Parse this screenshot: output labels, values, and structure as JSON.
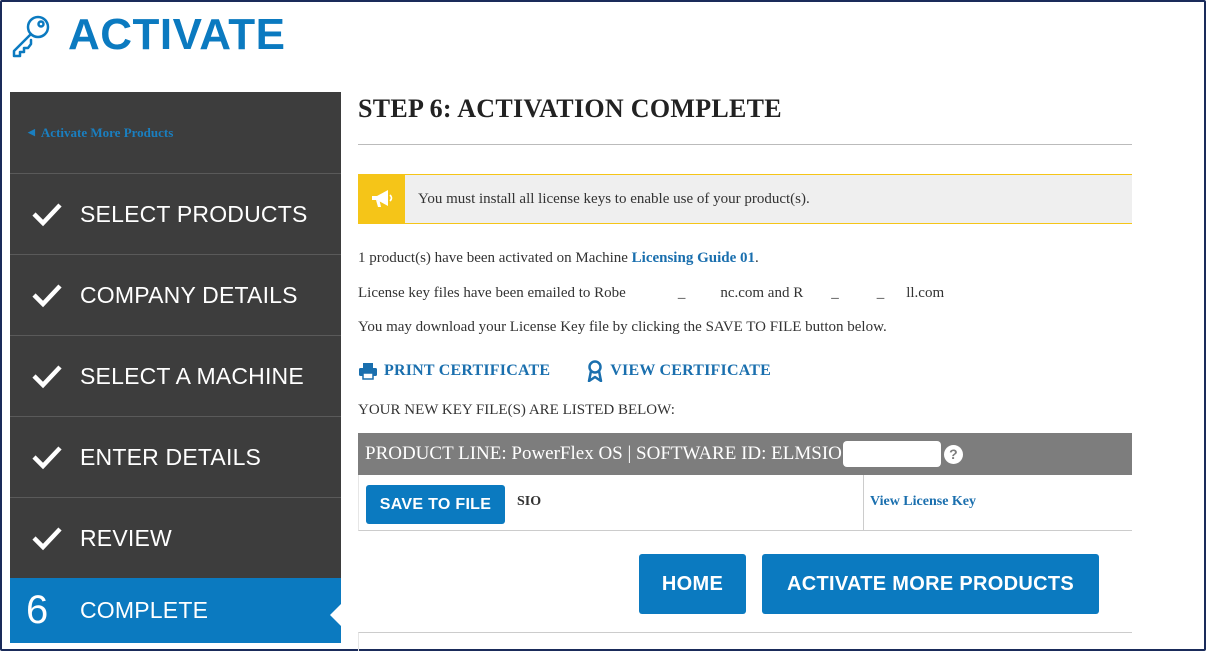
{
  "header": {
    "title": "ACTIVATE",
    "icon": "key-icon",
    "accent_color": "#0b7ac0"
  },
  "sidebar": {
    "back_link": "Activate More Products",
    "steps": [
      {
        "label": "SELECT PRODUCTS",
        "state": "done"
      },
      {
        "label": "COMPANY DETAILS",
        "state": "done"
      },
      {
        "label": "SELECT A MACHINE",
        "state": "done"
      },
      {
        "label": "ENTER DETAILS",
        "state": "done"
      },
      {
        "label": "REVIEW",
        "state": "done"
      },
      {
        "label": "COMPLETE",
        "state": "active",
        "number": "6"
      }
    ],
    "background": "#3d3d3d",
    "active_color": "#0b7ac0"
  },
  "main": {
    "step_title": "STEP 6: ACTIVATION COMPLETE",
    "notice": {
      "icon": "megaphone-icon",
      "text": "You must install all license keys to enable use of your product(s)."
    },
    "activated_prefix": "1 product(s) have been activated on Machine ",
    "machine_name": "Licensing Guide 01",
    "activated_suffix": ".",
    "emailed_prefix": "License key files have been emailed to Robe",
    "emailed_mid1": "nc.com and R",
    "emailed_mid2": "ll.com",
    "download_text": "You may download your License Key file by clicking the SAVE TO FILE button below.",
    "print_certificate": "PRINT CERTIFICATE",
    "view_certificate": "VIEW CERTIFICATE",
    "listed_text": "YOUR NEW KEY FILE(S) ARE LISTED BELOW:",
    "product_line": "PRODUCT LINE: PowerFlex OS | SOFTWARE ID: ELMSIO",
    "save_to_file": "SAVE TO FILE",
    "file_name": "SIO",
    "view_license_key": "View License Key",
    "home_button": "HOME",
    "activate_more_button": "ACTIVATE MORE PRODUCTS"
  }
}
